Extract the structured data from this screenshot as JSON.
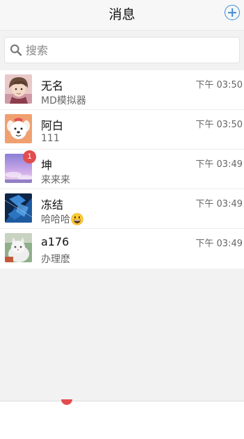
{
  "header": {
    "title": "消息",
    "add_icon": "add-circle-icon",
    "accent_color": "#3a8dd6"
  },
  "search": {
    "placeholder": "搜索",
    "value": "",
    "icon": "search-icon"
  },
  "chats": [
    {
      "name": "无名",
      "preview": "MD模拟器",
      "time": "下午 03:50",
      "unread": null,
      "avatar_icon": "anime-boy-avatar"
    },
    {
      "name": "阿白",
      "preview": "111",
      "time": "下午 03:50",
      "unread": null,
      "avatar_icon": "white-dog-avatar"
    },
    {
      "name": "坤",
      "preview": "来来来",
      "time": "下午 03:49",
      "unread": "1",
      "avatar_icon": "purple-sky-avatar"
    },
    {
      "name": "冻结",
      "preview": "哈哈哈",
      "time": "下午 03:49",
      "unread": null,
      "avatar_icon": "blue-tech-avatar",
      "preview_emoji": "grinning-face-emoji"
    },
    {
      "name": "a176",
      "preview": "办理麽",
      "time": "下午 03:49",
      "unread": null,
      "avatar_icon": "cat-photo-avatar"
    }
  ],
  "badge_color": "#e24d4d"
}
